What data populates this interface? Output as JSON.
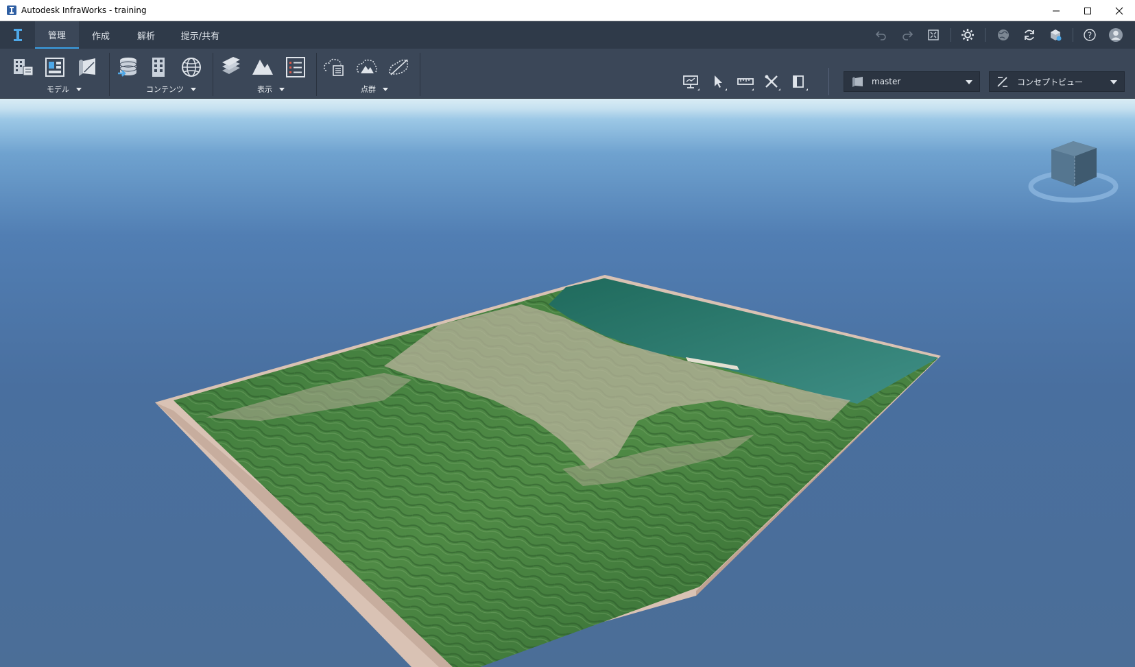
{
  "window": {
    "title": "Autodesk InfraWorks - training",
    "controls": [
      "minimize-icon",
      "maximize-icon",
      "close-icon"
    ]
  },
  "tabs": [
    {
      "label": "管理",
      "active": true
    },
    {
      "label": "作成",
      "active": false
    },
    {
      "label": "解析",
      "active": false
    },
    {
      "label": "提示/共有",
      "active": false
    }
  ],
  "quick_toolbar": [
    "undo-icon",
    "redo-icon",
    "fit-view-icon",
    "settings-icon",
    "globe-icon",
    "sync-icon",
    "cloud-model-icon",
    "help-icon",
    "user-icon"
  ],
  "ribbon": {
    "groups": [
      {
        "label": "モデル",
        "buttons": [
          "model-properties-icon",
          "model-layout-icon",
          "model-sheet-icon"
        ]
      },
      {
        "label": "コンテンツ",
        "buttons": [
          "data-sources-icon",
          "buildings-icon",
          "globe-mesh-icon"
        ]
      },
      {
        "label": "表示",
        "buttons": [
          "layers-icon",
          "terrain-icon",
          "list-icon"
        ]
      },
      {
        "label": "点群",
        "buttons": [
          "point-cloud-icon",
          "point-cloud-terrain-icon",
          "point-cloud-line-icon"
        ]
      }
    ],
    "tools": [
      "presentation-icon",
      "select-icon",
      "measure-icon",
      "tools-icon",
      "panel-icon"
    ],
    "proposal": {
      "value": "master"
    },
    "visual_style": {
      "value": "コンセプトビュー"
    }
  },
  "colors": {
    "titlebar": "#ffffff",
    "tabrow": "#2f3a49",
    "ribbon": "#3b4758",
    "accent": "#3aa0e6",
    "sky_top": "#d9ecf5",
    "sky_bottom": "#4b6e97"
  }
}
